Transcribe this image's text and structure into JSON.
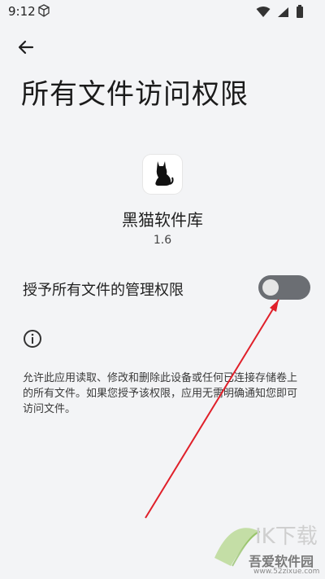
{
  "status_bar": {
    "time": "9:12",
    "left_icon": "cube-icon",
    "right_icons": [
      "wifi-icon",
      "signal-icon",
      "battery-icon"
    ]
  },
  "header": {
    "back_icon": "arrow-left-icon",
    "title": "所有文件访问权限"
  },
  "app": {
    "icon": "black-cat-icon",
    "name": "黑猫软件库",
    "version": "1.6"
  },
  "permission": {
    "label": "授予所有文件的管理权限",
    "enabled": false
  },
  "info": {
    "icon": "info-icon",
    "description": "允许此应用读取、修改和删除此设备或任何已连接存储卷上的所有文件。如果您授予该权限，应用无需明确通知您即可访问文件。"
  },
  "watermark": {
    "site": "吾爱软件园",
    "url": "www.52zixue.com"
  },
  "colors": {
    "background": "#f3f4f6",
    "toggle_track": "#6b6e73",
    "arrow": "#e0202a"
  }
}
